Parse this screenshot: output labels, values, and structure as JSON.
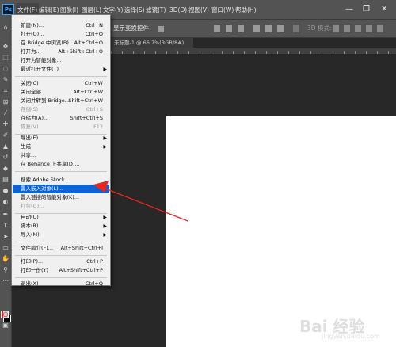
{
  "app": {
    "logo": "Ps"
  },
  "menubar": {
    "items": [
      "文件(F)",
      "编辑(E)",
      "图像(I)",
      "图层(L)",
      "文字(Y)",
      "选择(S)",
      "滤镜(T)",
      "3D(D)",
      "视图(V)",
      "窗口(W)",
      "帮助(H)"
    ],
    "window_controls": [
      "—",
      "❐",
      "✕"
    ]
  },
  "options_bar": {
    "show_transform_controls": "显示变换控件",
    "mode_label": "3D 模式:"
  },
  "document_tab": {
    "title": "未标题-1 @ 66.7%(RGB/8#)"
  },
  "file_menu": {
    "items": [
      {
        "label": "新建(N)...",
        "shortcut": "Ctrl+N"
      },
      {
        "label": "打开(O)...",
        "shortcut": "Ctrl+O"
      },
      {
        "label": "在 Bridge 中浏览(B)...",
        "shortcut": "Alt+Ctrl+O"
      },
      {
        "label": "打开为...",
        "shortcut": "Alt+Shift+Ctrl+O"
      },
      {
        "label": "打开为智能对象..."
      },
      {
        "label": "最近打开文件(T)",
        "submenu": true
      },
      {
        "label": "关闭(C)",
        "shortcut": "Ctrl+W"
      },
      {
        "label": "关闭全部",
        "shortcut": "Alt+Ctrl+W"
      },
      {
        "label": "关闭并转到 Bridge...",
        "shortcut": "Shift+Ctrl+W"
      },
      {
        "label": "存储(S)",
        "shortcut": "Ctrl+S",
        "disabled": true
      },
      {
        "label": "存储为(A)...",
        "shortcut": "Shift+Ctrl+S"
      },
      {
        "label": "恢复(V)",
        "shortcut": "F12",
        "disabled": true
      },
      {
        "label": "导出(E)",
        "submenu": true
      },
      {
        "label": "生成",
        "submenu": true
      },
      {
        "label": "共享..."
      },
      {
        "label": "在 Behance 上共享(D)..."
      },
      {
        "label": "搜索 Adobe Stock..."
      },
      {
        "label": "置入嵌入对象(L)...",
        "highlighted": true
      },
      {
        "label": "置入链接的智能对象(K)..."
      },
      {
        "label": "打包(G)...",
        "disabled": true
      },
      {
        "label": "自动(U)",
        "submenu": true
      },
      {
        "label": "脚本(R)",
        "submenu": true
      },
      {
        "label": "导入(M)",
        "submenu": true
      },
      {
        "label": "文件简介(F)...",
        "shortcut": "Alt+Shift+Ctrl+I"
      },
      {
        "label": "打印(P)...",
        "shortcut": "Ctrl+P"
      },
      {
        "label": "打印一份(Y)",
        "shortcut": "Alt+Shift+Ctrl+P"
      },
      {
        "label": "退出(X)",
        "shortcut": "Ctrl+Q"
      }
    ]
  },
  "colors": {
    "foreground": "#e10000",
    "background": "#000000",
    "highlight": "#0a64d3",
    "annotation_arrow": "#e8261e"
  },
  "toolbar": {
    "icons": [
      "home-icon",
      "move-icon",
      "marquee-icon",
      "lasso-icon",
      "quick-select-icon",
      "crop-icon",
      "frame-icon",
      "eyedropper-icon",
      "healing-icon",
      "brush-icon",
      "stamp-icon",
      "history-brush-icon",
      "eraser-icon",
      "gradient-icon",
      "blur-icon",
      "dodge-icon",
      "pen-icon",
      "type-icon",
      "path-select-icon",
      "shape-icon",
      "hand-icon",
      "zoom-icon",
      "more-icon"
    ]
  },
  "watermark": {
    "text": "Bai 经验",
    "sub": "jingyan.baidu.com"
  }
}
